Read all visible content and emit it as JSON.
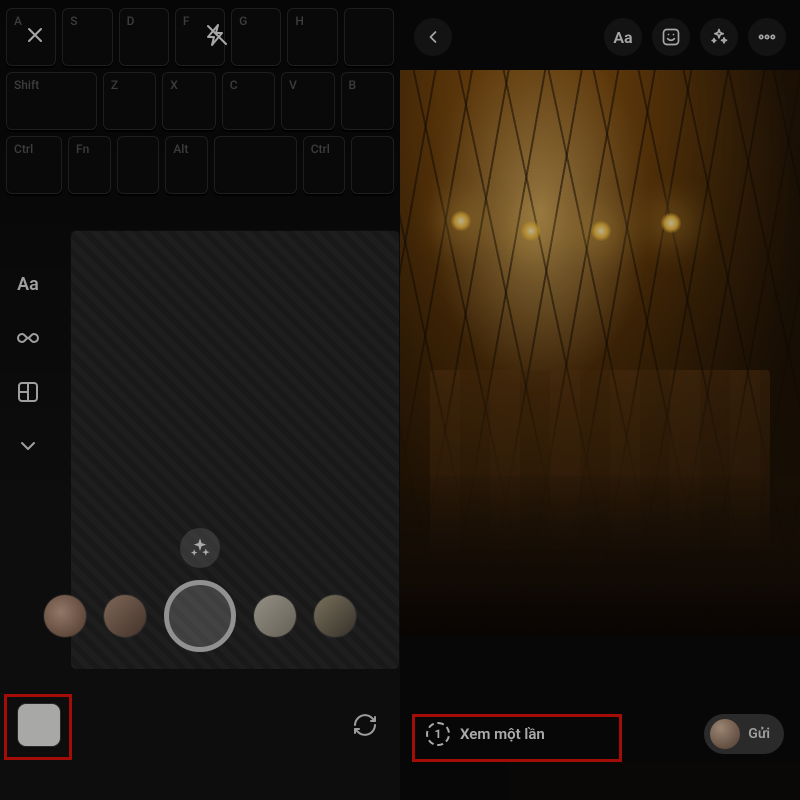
{
  "left": {
    "keys_row1": [
      "A",
      "S",
      "D",
      "F",
      "G",
      "H",
      ""
    ],
    "keys_row2": [
      "Shift",
      "Z",
      "X",
      "C",
      "V",
      "B"
    ],
    "keys_row3": [
      "Ctrl",
      "Fn",
      "",
      "Alt",
      "",
      "Ctrl",
      ""
    ],
    "side": {
      "text_tool": "Aa"
    }
  },
  "right": {
    "top": {
      "text_tool": "Aa"
    },
    "view_once": {
      "badge": "1",
      "label": "Xem một lần"
    },
    "send": {
      "label": "Gửi"
    }
  }
}
